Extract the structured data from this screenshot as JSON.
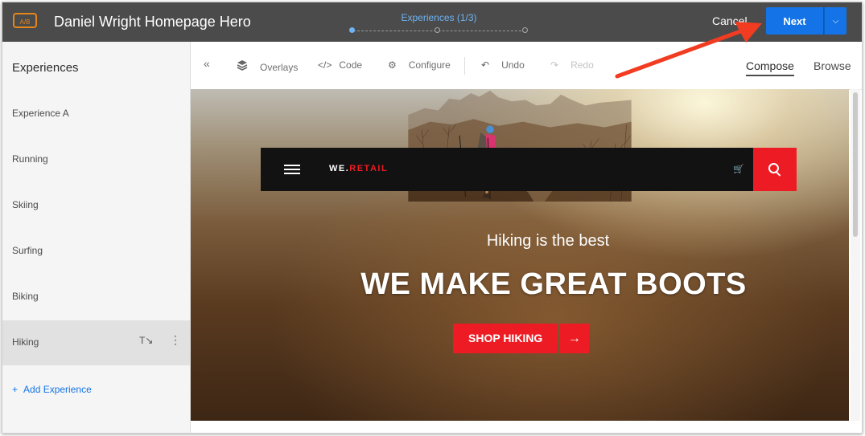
{
  "header": {
    "badge": "A/B",
    "title": "Daniel Wright Homepage Hero",
    "steps_label": "Experiences (1/3)",
    "cancel": "Cancel",
    "next": "Next",
    "next_dropdown_icon": "chevron-down-icon",
    "accent": "#1473e6"
  },
  "sidebar": {
    "title": "Experiences",
    "items": [
      {
        "label": "Experience A"
      },
      {
        "label": "Running"
      },
      {
        "label": "Skiing"
      },
      {
        "label": "Surfing"
      },
      {
        "label": "Biking"
      },
      {
        "label": "Hiking"
      }
    ],
    "add_label": "Add Experience",
    "add_icon": "+"
  },
  "toolbar": {
    "collapse_icon": "«",
    "overlays": "Overlays",
    "code": "Code",
    "configure": "Configure",
    "undo": "Undo",
    "redo": "Redo",
    "compose": "Compose",
    "browse": "Browse"
  },
  "canvas": {
    "brand_prefix": "WE.",
    "brand_suffix": "RETAIL",
    "hero_subtitle": "Hiking is the best",
    "hero_title": "WE MAKE GREAT BOOTS",
    "cta_label": "SHOP HIKING",
    "cta_arrow": "→",
    "cart_icon": "🛒",
    "brand_red": "#ed1c24"
  }
}
